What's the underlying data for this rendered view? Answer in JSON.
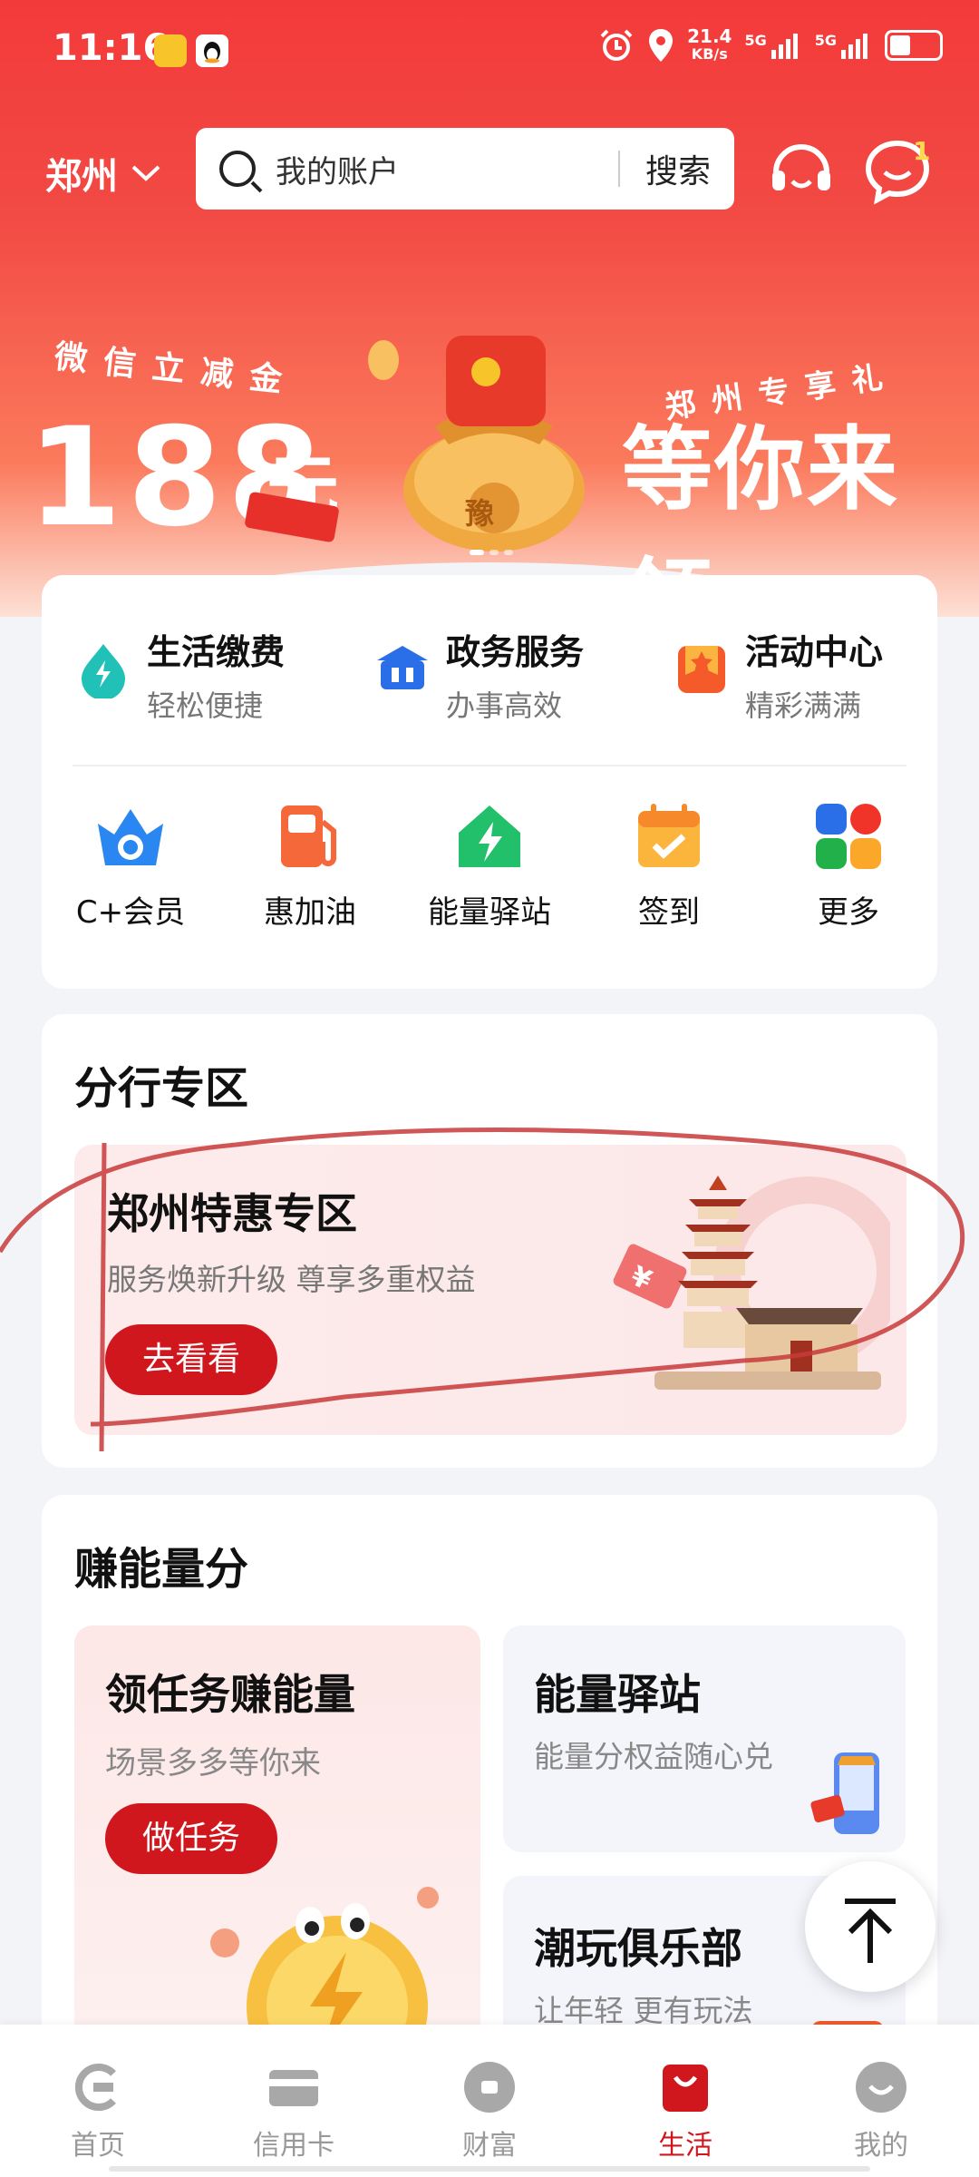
{
  "status_bar": {
    "time": "11:16",
    "net_speed": "21.4",
    "net_unit": "KB/s",
    "sim1": "5G",
    "sim2": "5G"
  },
  "header": {
    "city": "郑州",
    "search_placeholder": "我的账户",
    "search_button": "搜索",
    "message_badge": "1"
  },
  "banner": {
    "small_left": "微信立减金",
    "amount": "188",
    "unit": "元",
    "small_right": "郑州专享礼",
    "big_right": "等你来领",
    "bag_char": "豫"
  },
  "services": [
    {
      "title": "生活缴费",
      "subtitle": "轻松便捷",
      "icon": "lightning-droplet-icon"
    },
    {
      "title": "政务服务",
      "subtitle": "办事高效",
      "icon": "government-building-icon"
    },
    {
      "title": "活动中心",
      "subtitle": "精彩满满",
      "icon": "star-flag-icon"
    }
  ],
  "quick_items": [
    {
      "label": "C+会员",
      "icon": "crown-icon"
    },
    {
      "label": "惠加油",
      "icon": "fuel-pump-icon"
    },
    {
      "label": "能量驿站",
      "icon": "energy-house-icon"
    },
    {
      "label": "签到",
      "icon": "calendar-check-icon"
    },
    {
      "label": "更多",
      "icon": "grid-more-icon"
    }
  ],
  "branch": {
    "section_title": "分行专区",
    "promo_title": "郑州特惠专区",
    "promo_subtitle": "服务焕新升级 尊享多重权益",
    "promo_button": "去看看",
    "coupon_symbol": "¥"
  },
  "earn": {
    "section_title": "赚能量分",
    "task_title": "领任务赚能量",
    "task_subtitle": "场景多多等你来",
    "task_button": "做任务",
    "station_title": "能量驿站",
    "station_subtitle": "能量分权益随心兑",
    "club_title": "潮玩俱乐部",
    "club_subtitle": "让年轻 更有玩法"
  },
  "tabs": [
    {
      "label": "首页",
      "icon": "home-logo-icon",
      "active": false
    },
    {
      "label": "信用卡",
      "icon": "credit-card-icon",
      "active": false
    },
    {
      "label": "财富",
      "icon": "wealth-coin-icon",
      "active": false
    },
    {
      "label": "生活",
      "icon": "shopping-bag-icon",
      "active": true
    },
    {
      "label": "我的",
      "icon": "smiley-face-icon",
      "active": false
    }
  ],
  "colors": {
    "brand_red": "#d0171e",
    "header_red": "#f33a3a",
    "background": "#f3f4f8"
  }
}
